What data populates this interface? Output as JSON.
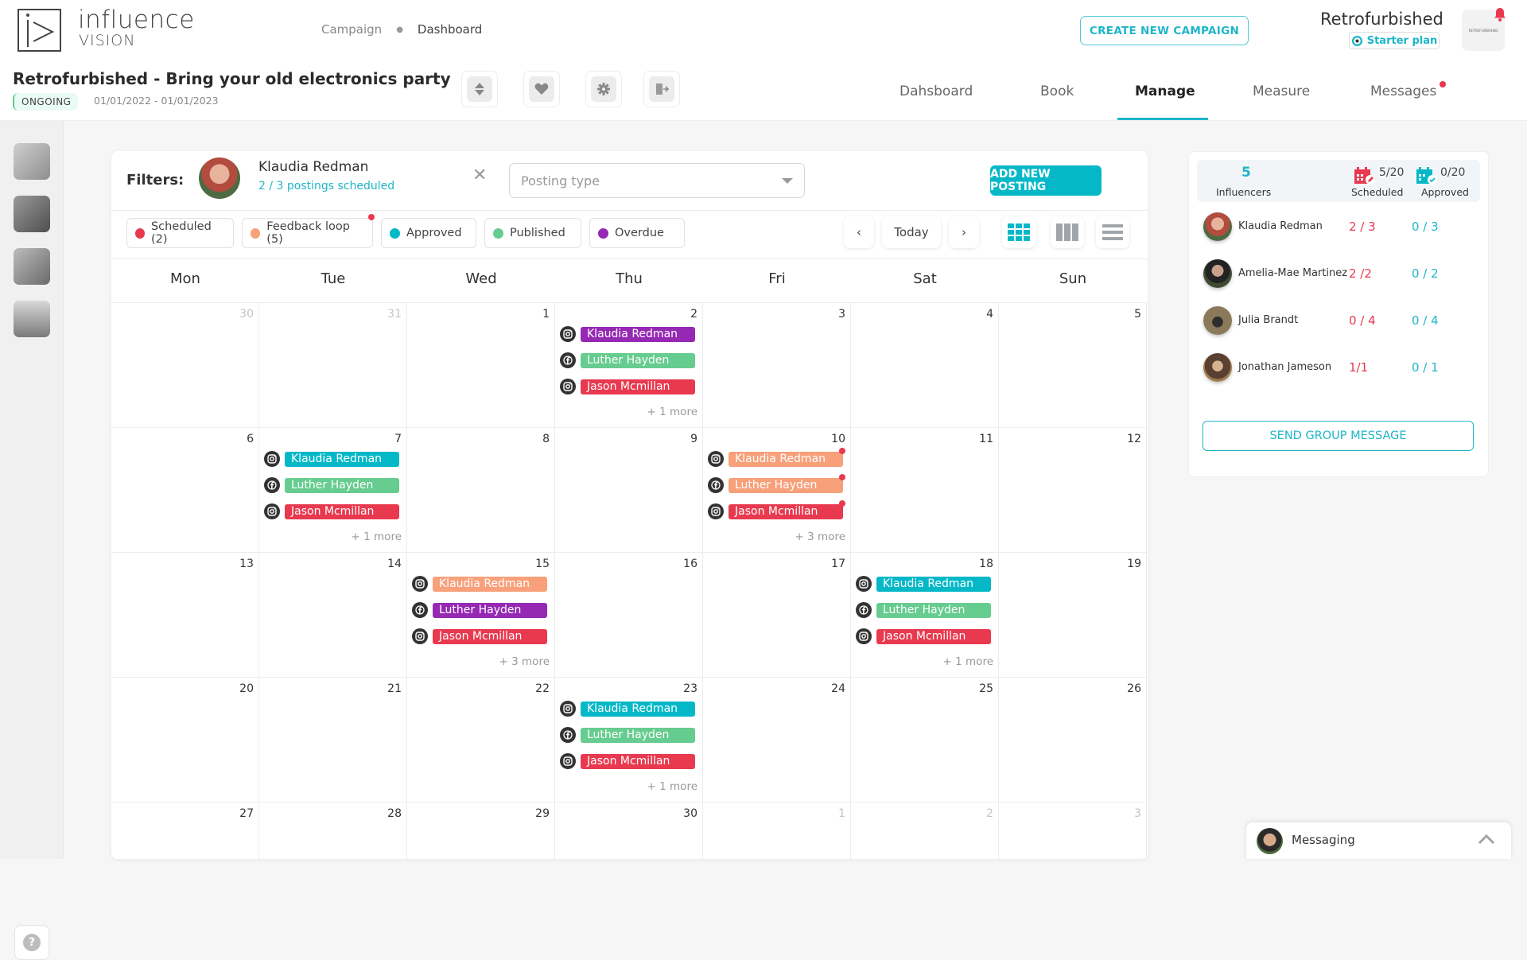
{
  "header": {
    "logo_main": "influence",
    "logo_sub": "VISION",
    "breadcrumb": [
      "Campaign",
      "Dashboard"
    ],
    "create_button": "CREATE NEW CAMPAIGN",
    "brand_name": "Retrofurbished",
    "plan_label": "Starter plan",
    "brand_logo_text": "RETROFURBISHED",
    "notification_icon": "bell-icon"
  },
  "campaign": {
    "title": "Retrofurbished - Bring your old electronics party",
    "status": "ONGOING",
    "dates": "01/01/2022 - 01/01/2023",
    "tools": [
      "sort-icon",
      "heart-icon",
      "gear-icon",
      "exit-icon"
    ]
  },
  "tabs": [
    {
      "label": "Dahsboard",
      "active": false
    },
    {
      "label": "Book",
      "active": false
    },
    {
      "label": "Manage",
      "active": true
    },
    {
      "label": "Measure",
      "active": false
    },
    {
      "label": "Messages",
      "active": false,
      "has_notification": true
    }
  ],
  "filters": {
    "label": "Filters:",
    "influencer_name": "Klaudia Redman",
    "influencer_sub": "2 / 3 postings scheduled",
    "posting_type_placeholder": "Posting type",
    "add_button": "ADD NEW POSTING"
  },
  "legend": [
    {
      "label": "Scheduled (2)",
      "color": "#e8394f"
    },
    {
      "label": "Feedback loop (5)",
      "color": "#f7a07a",
      "notification": true
    },
    {
      "label": "Approved",
      "color": "#05b8c8"
    },
    {
      "label": "Published",
      "color": "#66cc8f"
    },
    {
      "label": "Overdue",
      "color": "#9629b4"
    }
  ],
  "calendar_nav": {
    "prev": "‹",
    "today": "Today",
    "next": "›",
    "views": [
      "month-grid",
      "week-columns",
      "list"
    ]
  },
  "weekdays": [
    "Mon",
    "Tue",
    "Wed",
    "Thu",
    "Fri",
    "Sat",
    "Sun"
  ],
  "status_colors": {
    "scheduled": "#e8394f",
    "feedback": "#f7a07a",
    "approved": "#05b8c8",
    "published": "#66cc8f",
    "overdue": "#9629b4"
  },
  "weeks": [
    [
      {
        "day": "30",
        "dim": true
      },
      {
        "day": "31",
        "dim": true
      },
      {
        "day": "1"
      },
      {
        "day": "2",
        "posts": [
          {
            "platform": "instagram",
            "name": "Klaudia Redman",
            "status": "overdue"
          },
          {
            "platform": "facebook",
            "name": "Luther Hayden",
            "status": "published"
          },
          {
            "platform": "instagram",
            "name": "Jason Mcmillan",
            "status": "scheduled"
          }
        ],
        "more": "+ 1 more"
      },
      {
        "day": "3"
      },
      {
        "day": "4"
      },
      {
        "day": "5"
      }
    ],
    [
      {
        "day": "6"
      },
      {
        "day": "7",
        "posts": [
          {
            "platform": "instagram",
            "name": "Klaudia Redman",
            "status": "approved"
          },
          {
            "platform": "facebook",
            "name": "Luther Hayden",
            "status": "published"
          },
          {
            "platform": "instagram",
            "name": "Jason Mcmillan",
            "status": "scheduled"
          }
        ],
        "more": "+ 1 more"
      },
      {
        "day": "8"
      },
      {
        "day": "9"
      },
      {
        "day": "10",
        "posts": [
          {
            "platform": "instagram",
            "name": "Klaudia Redman",
            "status": "feedback",
            "notification": true
          },
          {
            "platform": "facebook",
            "name": "Luther Hayden",
            "status": "feedback",
            "notification": true
          },
          {
            "platform": "instagram",
            "name": "Jason Mcmillan",
            "status": "scheduled",
            "notification": true
          }
        ],
        "more": "+ 3 more"
      },
      {
        "day": "11"
      },
      {
        "day": "12"
      }
    ],
    [
      {
        "day": "13"
      },
      {
        "day": "14"
      },
      {
        "day": "15",
        "posts": [
          {
            "platform": "instagram",
            "name": "Klaudia Redman",
            "status": "feedback"
          },
          {
            "platform": "facebook",
            "name": "Luther Hayden",
            "status": "overdue"
          },
          {
            "platform": "instagram",
            "name": "Jason Mcmillan",
            "status": "scheduled"
          }
        ],
        "more": "+ 3 more"
      },
      {
        "day": "16"
      },
      {
        "day": "17"
      },
      {
        "day": "18",
        "posts": [
          {
            "platform": "instagram",
            "name": "Klaudia Redman",
            "status": "approved"
          },
          {
            "platform": "facebook",
            "name": "Luther Hayden",
            "status": "published"
          },
          {
            "platform": "instagram",
            "name": "Jason Mcmillan",
            "status": "scheduled"
          }
        ],
        "more": "+ 1 more"
      },
      {
        "day": "19"
      }
    ],
    [
      {
        "day": "20"
      },
      {
        "day": "21"
      },
      {
        "day": "22"
      },
      {
        "day": "23",
        "posts": [
          {
            "platform": "instagram",
            "name": "Klaudia Redman",
            "status": "approved"
          },
          {
            "platform": "facebook",
            "name": "Luther Hayden",
            "status": "published"
          },
          {
            "platform": "instagram",
            "name": "Jason Mcmillan",
            "status": "scheduled"
          }
        ],
        "more": "+ 1 more"
      },
      {
        "day": "24"
      },
      {
        "day": "25"
      },
      {
        "day": "26"
      }
    ],
    [
      {
        "day": "27"
      },
      {
        "day": "28"
      },
      {
        "day": "29"
      },
      {
        "day": "30"
      },
      {
        "day": "1",
        "dim": true
      },
      {
        "day": "2",
        "dim": true
      },
      {
        "day": "3",
        "dim": true
      }
    ]
  ],
  "summary": {
    "influencers_count": "5",
    "influencers_label": "Influencers",
    "scheduled_value": "5/20",
    "scheduled_label": "Scheduled",
    "approved_value": "0/20",
    "approved_label": "Approved",
    "rows": [
      {
        "name": "Klaudia Redman",
        "scheduled": "2 / 3",
        "approved": "0 / 3"
      },
      {
        "name": "Amelia-Mae Martinez",
        "scheduled": "2 /2",
        "approved": "0 / 2"
      },
      {
        "name": "Julia Brandt",
        "scheduled": "0 / 4",
        "approved": "0 / 4"
      },
      {
        "name": "Jonathan Jameson",
        "scheduled": "1/1",
        "approved": "0 / 1"
      }
    ],
    "group_button": "SEND GROUP MESSAGE"
  },
  "messaging": {
    "label": "Messaging"
  }
}
